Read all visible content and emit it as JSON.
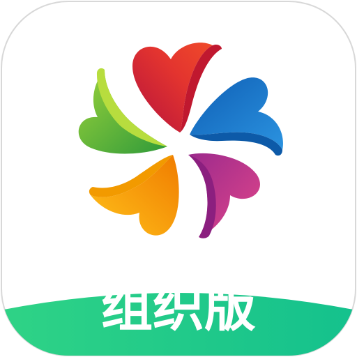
{
  "icon": {
    "label": "组织版",
    "logo_name": "pinwheel-logo"
  },
  "colors": {
    "background": "#ffffff",
    "border": "#dddddd",
    "banner_start": "#26d07c",
    "banner_end": "#12c08a",
    "label_text": "#ffffff",
    "petal_red": "#e3342f",
    "petal_blue": "#1e7fd0",
    "petal_magenta": "#c8338a",
    "petal_orange": "#f59b00",
    "petal_green": "#5fb830"
  }
}
